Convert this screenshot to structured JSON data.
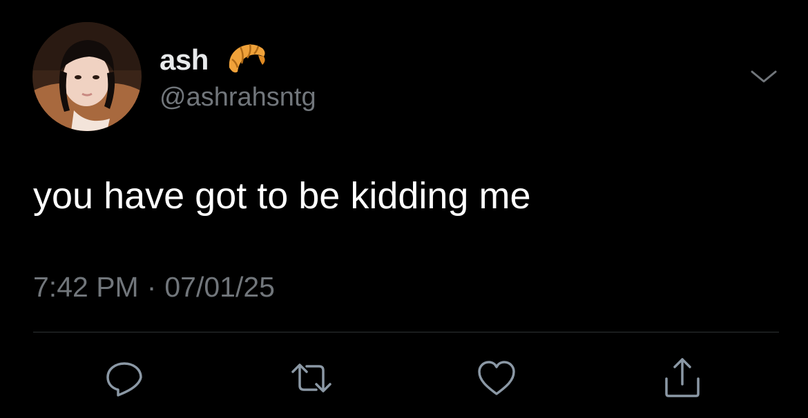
{
  "author": {
    "display_name": "ash",
    "emoji": "croissant-icon",
    "handle": "@ashrahsntg"
  },
  "tweet": {
    "text": "you have got to be kidding me",
    "time": "7:42 PM",
    "separator": "·",
    "date": "07/01/25"
  },
  "actions": [
    "reply-icon",
    "retweet-icon",
    "like-icon",
    "share-icon"
  ],
  "colors": {
    "background": "#000000",
    "text_primary": "#ffffff",
    "text_secondary": "#71767b",
    "divider": "#2f3336"
  }
}
